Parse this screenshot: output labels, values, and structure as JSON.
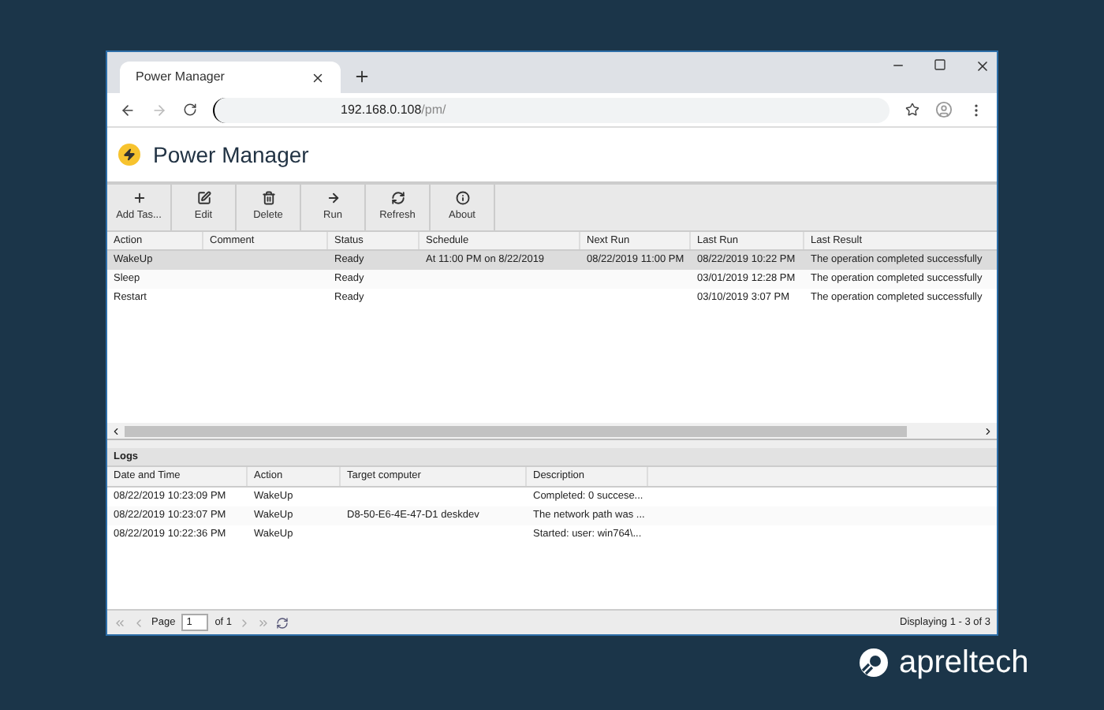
{
  "browser": {
    "tab_title": "Power Manager",
    "url_host": "192.168.0.108",
    "url_path": "/pm/"
  },
  "app": {
    "title": "Power Manager"
  },
  "toolbar": [
    {
      "label": "Add Tas...",
      "kind": "plus"
    },
    {
      "label": "Edit",
      "kind": "edit"
    },
    {
      "label": "Delete",
      "kind": "trash"
    },
    {
      "label": "Run",
      "kind": "arrow"
    },
    {
      "label": "Refresh",
      "kind": "refresh"
    },
    {
      "label": "About",
      "kind": "info"
    }
  ],
  "tasks": {
    "columns": [
      "Action",
      "Comment",
      "Status",
      "Schedule",
      "Next Run",
      "Last Run",
      "Last Result"
    ],
    "rows": [
      {
        "selected": true,
        "cells": [
          "WakeUp",
          "",
          "Ready",
          "At 11:00 PM on 8/22/2019",
          "08/22/2019 11:00 PM",
          "08/22/2019 10:22 PM",
          "The operation completed successfully"
        ]
      },
      {
        "selected": false,
        "cells": [
          "Sleep",
          "",
          "Ready",
          "",
          "",
          "03/01/2019 12:28 PM",
          "The operation completed successfully"
        ]
      },
      {
        "selected": false,
        "cells": [
          "Restart",
          "",
          "Ready",
          "",
          "",
          "03/10/2019 3:07 PM",
          "The operation completed successfully"
        ]
      }
    ]
  },
  "logs": {
    "title": "Logs",
    "columns": [
      "Date and Time",
      "Action",
      "Target computer",
      "Description"
    ],
    "rows": [
      [
        "08/22/2019 10:23:09 PM",
        "WakeUp",
        "",
        "Completed: 0 succese..."
      ],
      [
        "08/22/2019 10:23:07 PM",
        "WakeUp",
        "D8-50-E6-4E-47-D1 deskdev",
        "The network path was ..."
      ],
      [
        "08/22/2019 10:22:36 PM",
        "WakeUp",
        "",
        "Started: user: win764\\..."
      ]
    ]
  },
  "pager": {
    "page_label": "Page",
    "page": "1",
    "of_label": "of 1",
    "display": "Displaying 1 - 3 of 3"
  },
  "brand": "apreltech"
}
